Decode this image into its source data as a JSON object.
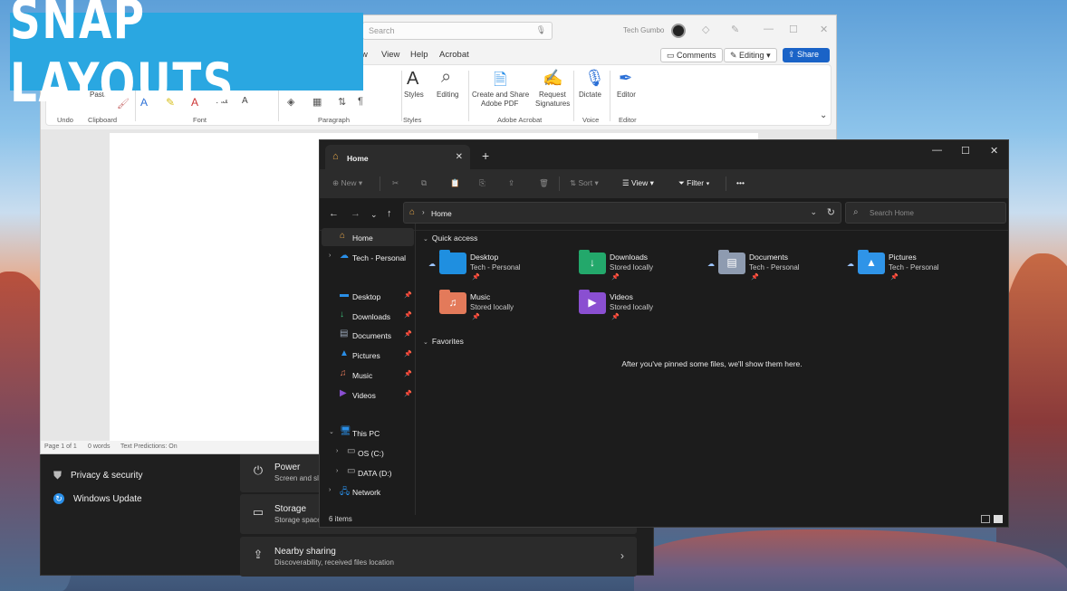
{
  "banner": {
    "text": "SNAP LAYOUTS"
  },
  "settings": {
    "nav_items": [
      {
        "label": "Privacy & security",
        "icon": "shield-icon"
      },
      {
        "label": "Windows Update",
        "icon": "refresh-icon"
      }
    ],
    "cards": [
      {
        "title": "Power",
        "subtitle": "Screen and sl",
        "icon": "power-icon"
      },
      {
        "title": "Storage",
        "subtitle": "Storage space",
        "icon": "storage-icon"
      },
      {
        "title": "Nearby sharing",
        "subtitle": "Discoverability, received files location",
        "icon": "share-icon"
      }
    ]
  },
  "word": {
    "search_placeholder": "Search",
    "user_name": "Tech Gumbo",
    "menu": [
      "w",
      "View",
      "Help",
      "Acrobat"
    ],
    "comments_label": "Comments",
    "editing_mode_label": "Editing",
    "share_label": "Share",
    "ribbon": {
      "paste_label": "Paste",
      "groups": [
        "Undo",
        "Clipboard",
        "Font",
        "Paragraph",
        "Styles",
        "Adobe Acrobat",
        "Voice",
        "Editor"
      ],
      "styles_label": "Styles",
      "editing_label": "Editing",
      "create_share_label_1": "Create and Share",
      "create_share_label_2": "Adobe PDF",
      "request_sig_label_1": "Request",
      "request_sig_label_2": "Signatures",
      "dictate_label": "Dictate",
      "editor_label": "Editor"
    },
    "status": {
      "page": "Page 1 of 1",
      "words": "0 words",
      "predictions": "Text Predictions: On"
    }
  },
  "explorer": {
    "tab_label": "Home",
    "commands": {
      "new": "New",
      "sort": "Sort",
      "view": "View",
      "filter": "Filter",
      "more": "•••"
    },
    "address": "Home",
    "search_placeholder": "Search Home",
    "nav": {
      "home": "Home",
      "tech_personal": "Tech - Personal",
      "desktop": "Desktop",
      "downloads": "Downloads",
      "documents": "Documents",
      "pictures": "Pictures",
      "music": "Music",
      "videos": "Videos",
      "this_pc": "This PC",
      "os_c": "OS (C:)",
      "data_d": "DATA (D:)",
      "network": "Network"
    },
    "quick_access_header": "Quick access",
    "quick_access": [
      {
        "name": "Desktop",
        "location": "Tech - Personal",
        "color": "#1f8fe0",
        "cloud": true
      },
      {
        "name": "Downloads",
        "location": "Stored locally",
        "color": "#23a86b",
        "cloud": false
      },
      {
        "name": "Documents",
        "location": "Tech - Personal",
        "color": "#8e9bb0",
        "cloud": true
      },
      {
        "name": "Pictures",
        "location": "Tech - Personal",
        "color": "#2f94e8",
        "cloud": true
      },
      {
        "name": "Music",
        "location": "Stored locally",
        "color": "#e37a5a",
        "cloud": false
      },
      {
        "name": "Videos",
        "location": "Stored locally",
        "color": "#8a4fd1",
        "cloud": false
      }
    ],
    "favorites_header": "Favorites",
    "favorites_empty": "After you've pinned some files, we'll show them here.",
    "status_count": "6 items"
  },
  "colors": {
    "accent": "#1a63c7",
    "banner": "#2aa7e1",
    "home_icon": "#e8a84a"
  }
}
